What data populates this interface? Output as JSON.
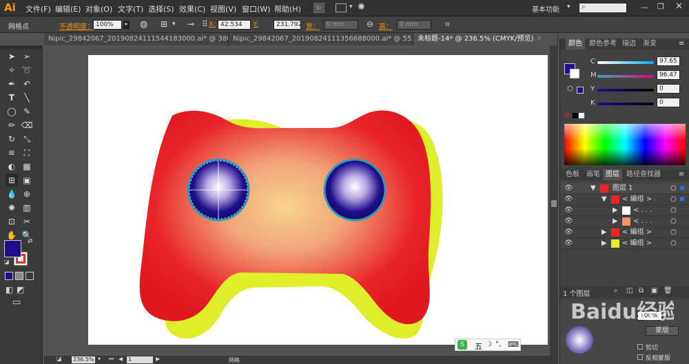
{
  "app": {
    "logo": "Ai"
  },
  "menu": [
    "文件(F)",
    "编辑(E)",
    "对象(O)",
    "文字(T)",
    "选择(S)",
    "效果(C)",
    "视图(V)",
    "窗口(W)",
    "帮助(H)"
  ],
  "workspace": {
    "label": "基本功能",
    "search_placeholder": ""
  },
  "control_bar": {
    "mode_label": "网格点",
    "opacity_label": "不透明度：",
    "opacity_value": "100%",
    "x_label": "X:",
    "x_value": "42.534",
    "y_label": "Y:",
    "y_value": "231.792",
    "w_label": "宽：",
    "w_value": "0 mm",
    "h_label": "高：",
    "h_value": "0 mm"
  },
  "doc_tabs": [
    {
      "label": "Nipic_29842067_20190824111544183000.ai* @ 380..."
    },
    {
      "label": "Nipic_29842067_20190824111356688000.ai* @ 55..."
    },
    {
      "label": "未标题-14* @ 236.5% (CMYK/预览)"
    }
  ],
  "status": {
    "zoom": "236.5%",
    "page": "1",
    "tool": "网格"
  },
  "ime": {
    "label": "五"
  },
  "color_panel": {
    "tabs": [
      "颜色",
      "颜色参考",
      "描边",
      "渐变"
    ],
    "channels": [
      {
        "name": "C",
        "value": "97.65",
        "color": "#d01c8b"
      },
      {
        "name": "M",
        "value": "96.47",
        "color": "#1a9bd6"
      },
      {
        "name": "Y",
        "value": "0",
        "color": "#e6e600"
      },
      {
        "name": "K",
        "value": "0",
        "color": "#000000"
      }
    ],
    "fill_color": "#1f0f8c"
  },
  "layers_panel": {
    "tabs": [
      "色板",
      "画笔",
      "图层",
      "路径查找器"
    ],
    "rows": [
      {
        "label": "图层 1",
        "indent": 0,
        "expanded": "▼"
      },
      {
        "label": "< 编组 >",
        "indent": 1,
        "expanded": "▼"
      },
      {
        "label": "< . . .",
        "indent": 2,
        "expanded": "▶"
      },
      {
        "label": "< . . .",
        "indent": 2,
        "expanded": "▶"
      },
      {
        "label": "< 编组 >",
        "indent": 1,
        "expanded": "▶"
      },
      {
        "label": "< 编组 >",
        "indent": 1,
        "expanded": "▶"
      }
    ],
    "footer": "1 个图层"
  },
  "transparency_panel": {
    "opacity_value": "100%",
    "mask_button": "蒙版",
    "clip_label": "剪切",
    "invert_label": "反相蒙版"
  },
  "watermark": {
    "text": "Baidu经验"
  },
  "colors": {
    "accent": "#1f0f8c",
    "gamepad_red": "#e8242b",
    "shadow_yellow": "#dfee2a"
  }
}
